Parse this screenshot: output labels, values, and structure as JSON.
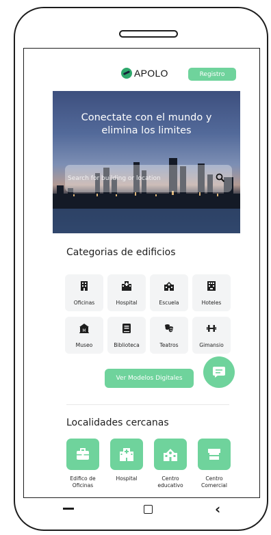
{
  "header": {
    "logo_text": "APOLO",
    "register_label": "Registro"
  },
  "hero": {
    "title_line1": "Conectate con el mundo y",
    "title_line2": "elimina los limites",
    "search_placeholder": "Search for building or location"
  },
  "categories": {
    "title": "Categorias de edificios",
    "items": [
      {
        "label": "Oficinas",
        "icon": "office-building-icon"
      },
      {
        "label": "Hospital",
        "icon": "hospital-icon"
      },
      {
        "label": "Escuela",
        "icon": "school-icon"
      },
      {
        "label": "Hoteles",
        "icon": "hotel-icon"
      },
      {
        "label": "Museo",
        "icon": "museum-icon"
      },
      {
        "label": "Biblioteca",
        "icon": "book-icon"
      },
      {
        "label": "Teatros",
        "icon": "theater-masks-icon"
      },
      {
        "label": "Gimansio",
        "icon": "dumbbell-icon"
      }
    ]
  },
  "actions": {
    "models_label": "Ver Modelos Digitales",
    "chat_icon": "chat-icon"
  },
  "nearby": {
    "title": "Localidades cercanas",
    "items": [
      {
        "label_line1": "Edifico de",
        "label_line2": "Oficinas",
        "icon": "briefcase-icon"
      },
      {
        "label_line1": "Hospital",
        "label_line2": "",
        "icon": "hospital-icon"
      },
      {
        "label_line1": "Centro",
        "label_line2": "educativo",
        "icon": "school-icon"
      },
      {
        "label_line1": "Centro",
        "label_line2": "Comercial",
        "icon": "store-icon"
      }
    ]
  },
  "colors": {
    "accent": "#6fd39c",
    "text": "#1e1e1e",
    "tile_bg": "#f3f4f5"
  }
}
